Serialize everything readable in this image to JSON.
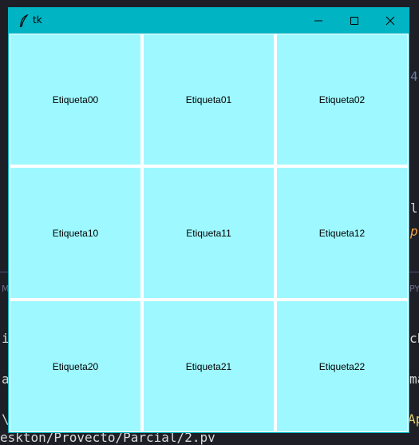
{
  "window": {
    "title": "tk",
    "controls": [
      "minimize",
      "maximize",
      "close"
    ]
  },
  "grid": {
    "rows": [
      [
        "Etiqueta00",
        "Etiqueta01",
        "Etiqueta02"
      ],
      [
        "Etiqueta10",
        "Etiqueta11",
        "Etiqueta12"
      ],
      [
        "Etiqueta20",
        "Etiqueta21",
        "Etiqueta22"
      ]
    ]
  },
  "background_editor": {
    "frag_4": "4",
    "frag_l": "l",
    "frag_p": "p",
    "frag_M": "M",
    "frag_PY": "PY",
    "frag_i": "i",
    "frag_ch": "ch",
    "frag_a": "a",
    "frag_ma": "ma",
    "frag_bs": "\\",
    "frag_Ap": "Ap",
    "path_text": "eskton/Provecto/Parcial/2.pv"
  },
  "colors": {
    "titlebar": "#00b4c3",
    "cell_bg": "#9ef8ff",
    "editor_bg": "#1e1f26"
  }
}
